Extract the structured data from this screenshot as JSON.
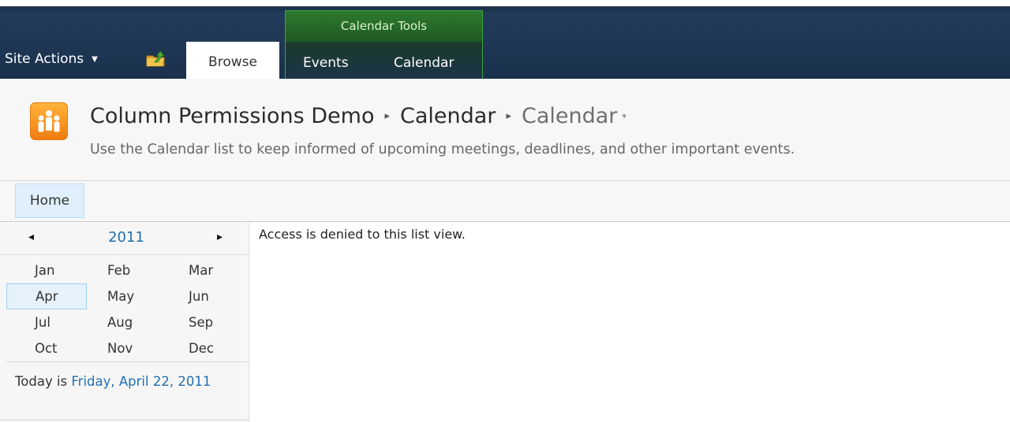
{
  "ribbon": {
    "site_actions_label": "Site Actions",
    "site_actions_caret": "▼",
    "browse_tab": "Browse",
    "context_group_title": "Calendar Tools",
    "context_tabs": [
      "Events",
      "Calendar"
    ],
    "context_accent": "#3ea53e"
  },
  "title_area": {
    "breadcrumb": [
      "Column Permissions Demo",
      "Calendar",
      "Calendar"
    ],
    "breadcrumb_separator": "▸",
    "current_caret": "▾",
    "description": "Use the Calendar list to keep informed of upcoming meetings, deadlines, and other important events."
  },
  "topnav": {
    "home_label": "Home"
  },
  "date_picker": {
    "prev_icon": "◂",
    "next_icon": "▸",
    "year": "2011",
    "months": [
      "Jan",
      "Feb",
      "Mar",
      "Apr",
      "May",
      "Jun",
      "Jul",
      "Aug",
      "Sep",
      "Oct",
      "Nov",
      "Dec"
    ],
    "selected_month": "Apr",
    "today_prefix": "Today is ",
    "today_link": "Friday, April 22, 2011"
  },
  "main": {
    "message": "Access is denied to this list view."
  },
  "colors": {
    "ribbon_bg": "#1e3550",
    "link": "#1f6fb2",
    "logo_orange": "#f7921e"
  }
}
